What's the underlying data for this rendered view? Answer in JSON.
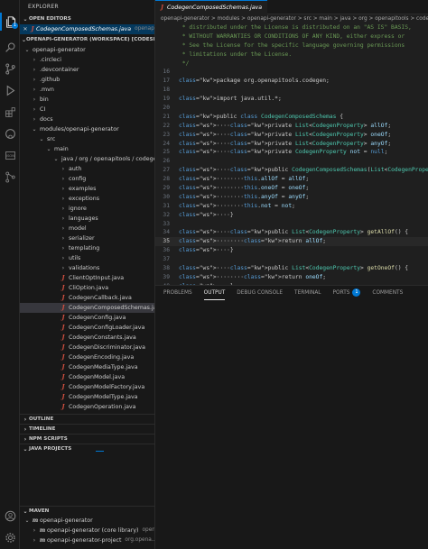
{
  "sidebar": {
    "title": "EXPLORER",
    "open_editors_label": "OPEN EDITORS",
    "open_editor": {
      "name": "CodegenComposedSchemas.java",
      "path": "openapi..."
    },
    "workspace_label": "OPENAPI-GENERATOR (WORKSPACE) [CODESPACES]",
    "tree": [
      {
        "label": "openapi-generator",
        "depth": 0,
        "type": "folder-open"
      },
      {
        "label": ".circleci",
        "depth": 1,
        "type": "folder"
      },
      {
        "label": ".devcontainer",
        "depth": 1,
        "type": "folder"
      },
      {
        "label": ".github",
        "depth": 1,
        "type": "folder"
      },
      {
        "label": ".mvn",
        "depth": 1,
        "type": "folder"
      },
      {
        "label": "bin",
        "depth": 1,
        "type": "folder"
      },
      {
        "label": "CI",
        "depth": 1,
        "type": "folder"
      },
      {
        "label": "docs",
        "depth": 1,
        "type": "folder"
      },
      {
        "label": "modules/openapi-generator",
        "depth": 1,
        "type": "folder-open"
      },
      {
        "label": "src",
        "depth": 2,
        "type": "folder-open"
      },
      {
        "label": "main",
        "depth": 3,
        "type": "folder-open"
      },
      {
        "label": "java / org / openapitools / codegen",
        "depth": 4,
        "type": "folder-open"
      },
      {
        "label": "auth",
        "depth": 5,
        "type": "folder"
      },
      {
        "label": "config",
        "depth": 5,
        "type": "folder"
      },
      {
        "label": "examples",
        "depth": 5,
        "type": "folder"
      },
      {
        "label": "exceptions",
        "depth": 5,
        "type": "folder"
      },
      {
        "label": "ignore",
        "depth": 5,
        "type": "folder"
      },
      {
        "label": "languages",
        "depth": 5,
        "type": "folder"
      },
      {
        "label": "model",
        "depth": 5,
        "type": "folder"
      },
      {
        "label": "serializer",
        "depth": 5,
        "type": "folder"
      },
      {
        "label": "templating",
        "depth": 5,
        "type": "folder"
      },
      {
        "label": "utils",
        "depth": 5,
        "type": "folder"
      },
      {
        "label": "validations",
        "depth": 5,
        "type": "folder"
      },
      {
        "label": "ClientOptInput.java",
        "depth": 5,
        "type": "java"
      },
      {
        "label": "CliOption.java",
        "depth": 5,
        "type": "java"
      },
      {
        "label": "CodegenCallback.java",
        "depth": 5,
        "type": "java"
      },
      {
        "label": "CodegenComposedSchemas.java",
        "depth": 5,
        "type": "java",
        "selected": true
      },
      {
        "label": "CodegenConfig.java",
        "depth": 5,
        "type": "java"
      },
      {
        "label": "CodegenConfigLoader.java",
        "depth": 5,
        "type": "java"
      },
      {
        "label": "CodegenConstants.java",
        "depth": 5,
        "type": "java"
      },
      {
        "label": "CodegenDiscriminator.java",
        "depth": 5,
        "type": "java"
      },
      {
        "label": "CodegenEncoding.java",
        "depth": 5,
        "type": "java"
      },
      {
        "label": "CodegenMediaType.java",
        "depth": 5,
        "type": "java"
      },
      {
        "label": "CodegenModel.java",
        "depth": 5,
        "type": "java"
      },
      {
        "label": "CodegenModelFactory.java",
        "depth": 5,
        "type": "java"
      },
      {
        "label": "CodegenModelType.java",
        "depth": 5,
        "type": "java"
      },
      {
        "label": "CodegenOperation.java",
        "depth": 5,
        "type": "java"
      }
    ],
    "outline_label": "OUTLINE",
    "timeline_label": "TIMELINE",
    "npm_label": "NPM SCRIPTS",
    "java_projects_label": "JAVA PROJECTS",
    "maven_label": "MAVEN",
    "maven_tree": [
      {
        "label": "openapi-generator",
        "sub": "",
        "depth": 0
      },
      {
        "label": "openapi-generator (core library)",
        "sub": "open...",
        "depth": 1
      },
      {
        "label": "openapi-generator-project",
        "sub": "org.opena...",
        "depth": 1
      }
    ]
  },
  "editor": {
    "tab_label": "CodegenComposedSchemas.java",
    "breadcrumbs": "openapi-generator > modules > openapi-generator > src > main > java > org > openapitools > codegen",
    "current_line": 35,
    "lines": [
      {
        "n": "",
        "t": " * distributed under the License is distributed on an \"AS IS\" BASIS,"
      },
      {
        "n": "",
        "t": " * WITHOUT WARRANTIES OR CONDITIONS OF ANY KIND, either express or"
      },
      {
        "n": "",
        "t": " * See the License for the specific language governing permissions"
      },
      {
        "n": "",
        "t": " * limitations under the License."
      },
      {
        "n": "",
        "t": " */"
      },
      {
        "n": "16",
        "t": ""
      },
      {
        "n": "17",
        "t": "package org.openapitools.codegen;"
      },
      {
        "n": "18",
        "t": ""
      },
      {
        "n": "19",
        "t": "import java.util.*;"
      },
      {
        "n": "20",
        "t": ""
      },
      {
        "n": "21",
        "t": "public class CodegenComposedSchemas {"
      },
      {
        "n": "22",
        "t": "    private List<CodegenProperty> allOf;"
      },
      {
        "n": "23",
        "t": "    private List<CodegenProperty> oneOf;"
      },
      {
        "n": "24",
        "t": "    private List<CodegenProperty> anyOf;"
      },
      {
        "n": "25",
        "t": "    private CodegenProperty not = null;"
      },
      {
        "n": "26",
        "t": ""
      },
      {
        "n": "27",
        "t": "    public CodegenComposedSchemas(List<CodegenProperty> allOf, List<"
      },
      {
        "n": "28",
        "t": "        this.allOf = allOf;"
      },
      {
        "n": "29",
        "t": "        this.oneOf = oneOf;"
      },
      {
        "n": "30",
        "t": "        this.anyOf = anyOf;"
      },
      {
        "n": "31",
        "t": "        this.not = not;"
      },
      {
        "n": "32",
        "t": "    }"
      },
      {
        "n": "33",
        "t": ""
      },
      {
        "n": "34",
        "t": "    public List<CodegenProperty> getAllOf() {"
      },
      {
        "n": "35",
        "t": "        return allOf;"
      },
      {
        "n": "36",
        "t": "    }"
      },
      {
        "n": "37",
        "t": ""
      },
      {
        "n": "38",
        "t": "    public List<CodegenProperty> getOneOf() {"
      },
      {
        "n": "39",
        "t": "        return oneOf;"
      },
      {
        "n": "40",
        "t": "    }"
      },
      {
        "n": "41",
        "t": ""
      }
    ]
  },
  "panel": {
    "tabs": [
      "PROBLEMS",
      "OUTPUT",
      "DEBUG CONSOLE",
      "TERMINAL",
      "PORTS",
      "COMMENTS"
    ],
    "active_tab": "OUTPUT",
    "ports_badge": "1"
  },
  "activity": {
    "icons": [
      "files-icon",
      "search-icon",
      "source-control-icon",
      "run-debug-icon",
      "extensions-icon",
      "github-icon",
      "json-icon",
      "git-graph-icon"
    ],
    "explorer_badge": "1"
  },
  "colors": {
    "accent": "#0078d4",
    "java_icon": "#d14f3f",
    "selection": "#37373d"
  }
}
